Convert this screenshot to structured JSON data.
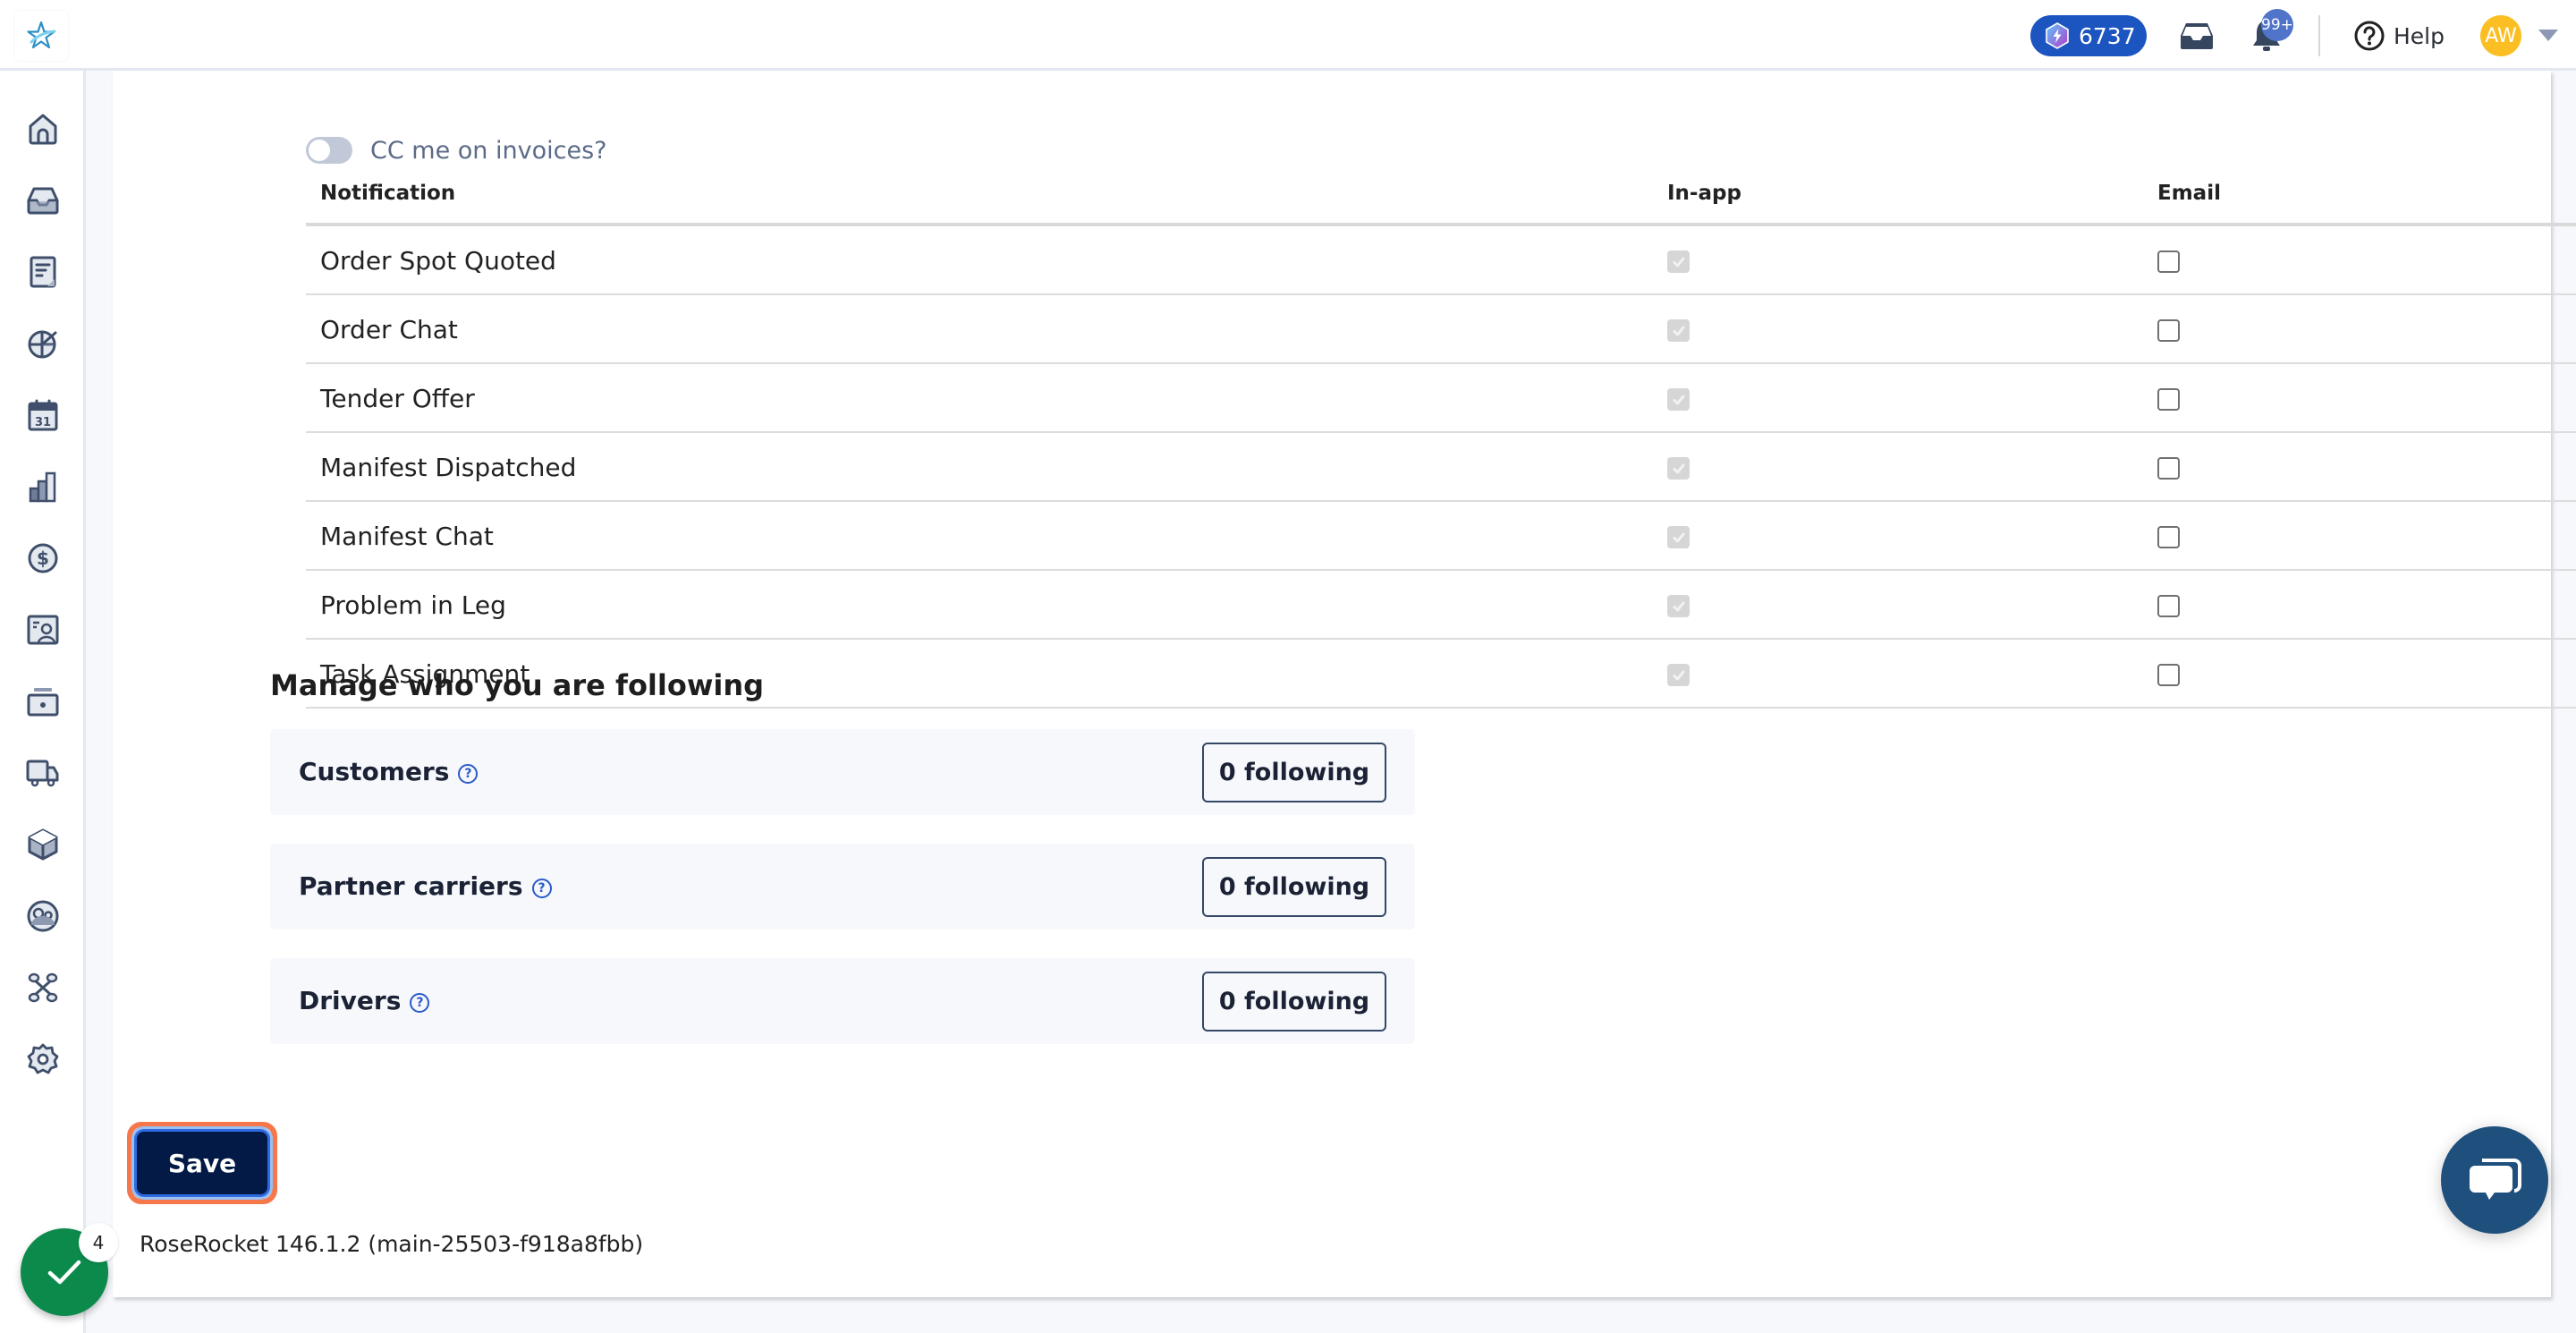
{
  "topbar": {
    "logo": "rose-rocket-star-logo",
    "points_value": "6737",
    "notifications_badge": "99+",
    "help_label": "Help",
    "avatar_initials": "AW"
  },
  "sidebar": {
    "items": [
      {
        "icon": "home-icon"
      },
      {
        "icon": "inbox-icon"
      },
      {
        "icon": "document-icon"
      },
      {
        "icon": "globe-dispatch-icon"
      },
      {
        "icon": "calendar-icon",
        "text": "31"
      },
      {
        "icon": "bar-chart-icon"
      },
      {
        "icon": "dollar-icon"
      },
      {
        "icon": "contact-card-icon"
      },
      {
        "icon": "register-icon"
      },
      {
        "icon": "truck-icon"
      },
      {
        "icon": "box-icon"
      },
      {
        "icon": "users-icon"
      },
      {
        "icon": "integrations-icon"
      },
      {
        "icon": "settings-icon"
      }
    ]
  },
  "cc_invoices": {
    "label": "CC me on invoices?",
    "enabled": false
  },
  "notifications_table": {
    "columns": [
      "Notification",
      "In-app",
      "Email"
    ],
    "rows": [
      {
        "name": "Order Spot Quoted",
        "in_app": true,
        "in_app_disabled": true,
        "email": false
      },
      {
        "name": "Order Chat",
        "in_app": true,
        "in_app_disabled": true,
        "email": false
      },
      {
        "name": "Tender Offer",
        "in_app": true,
        "in_app_disabled": true,
        "email": false
      },
      {
        "name": "Manifest Dispatched",
        "in_app": true,
        "in_app_disabled": true,
        "email": false
      },
      {
        "name": "Manifest Chat",
        "in_app": true,
        "in_app_disabled": true,
        "email": false
      },
      {
        "name": "Problem in Leg",
        "in_app": true,
        "in_app_disabled": true,
        "email": false
      },
      {
        "name": "Task Assignment",
        "in_app": true,
        "in_app_disabled": true,
        "email": false
      }
    ]
  },
  "following": {
    "title": "Manage who you are following",
    "groups": [
      {
        "label": "Customers",
        "button": "0 following"
      },
      {
        "label": "Partner carriers",
        "button": "0 following"
      },
      {
        "label": "Drivers",
        "button": "0 following"
      }
    ]
  },
  "actions": {
    "save_label": "Save"
  },
  "footer": {
    "version": "RoseRocket 146.1.2 (main-25503-f918a8fbb)"
  },
  "floating": {
    "tasks_count": "4",
    "chat": "chat-icon"
  },
  "colors": {
    "primary_dark": "#021a45",
    "points_blue": "#1c55c0",
    "success_green": "#0c8a4c",
    "chat_blue": "#1e4f7d",
    "avatar_yellow": "#fbbf24",
    "focus_orange": "#f6774a"
  }
}
